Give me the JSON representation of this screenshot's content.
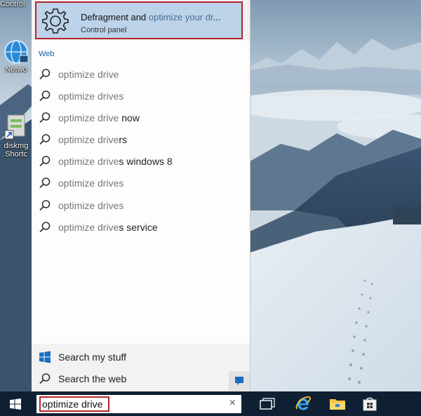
{
  "desktop": {
    "icons": [
      {
        "label_top": "Control",
        "name": "control-panel"
      },
      {
        "label": "Netwo",
        "name": "network"
      },
      {
        "label": "diskmg",
        "label2": "Shortc",
        "name": "diskmgmt-shortcut"
      }
    ]
  },
  "search_panel": {
    "best_match": {
      "title_before": "Defragment and ",
      "title_highlight": "optimize your dr",
      "title_after": "...",
      "subtitle": "Control panel",
      "icon": "gear-icon"
    },
    "section_header": "Web",
    "suggestions": [
      {
        "typed": "optimize drive",
        "rest": ""
      },
      {
        "typed": "optimize drives",
        "rest": ""
      },
      {
        "typed": "optimize drive",
        "rest": " now"
      },
      {
        "typed": "optimize drive",
        "rest": "rs"
      },
      {
        "typed": "optimize drive",
        "rest": "s windows 8"
      },
      {
        "typed": "optimize drives",
        "rest": ""
      },
      {
        "typed": "optimize drives",
        "rest": ""
      },
      {
        "typed": "optimize drive",
        "rest": "s service"
      }
    ],
    "search_my_stuff": "Search my stuff",
    "search_the_web": "Search the web"
  },
  "taskbar": {
    "search_value": "optimize drive",
    "clear_symbol": "×"
  },
  "colors": {
    "taskbar": "#0f2033",
    "highlight": "#bcd3ea",
    "accent_red": "#b3252b",
    "link_blue": "#1a5ea8"
  }
}
